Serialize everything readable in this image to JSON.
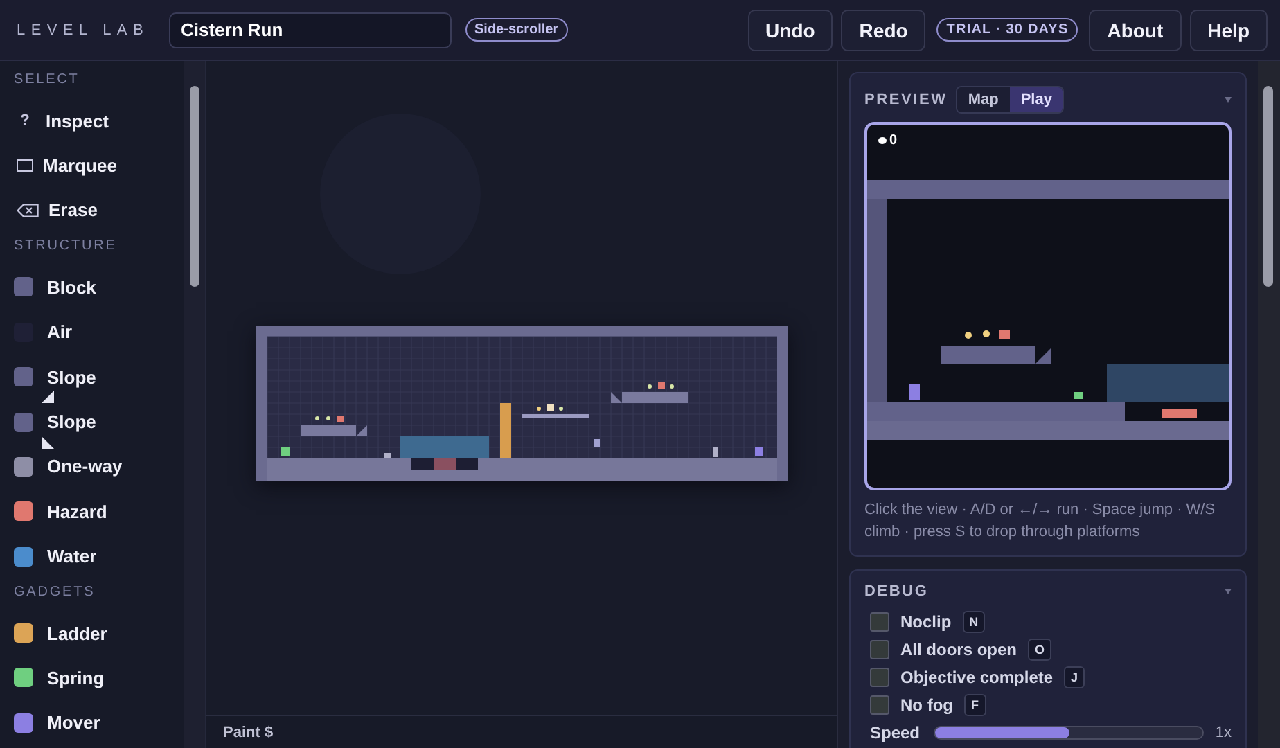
{
  "topbar": {
    "brand": "LEVEL LAB",
    "title_field": {
      "value": "Cistern Run"
    },
    "mode_badge": "Side-scroller",
    "buttons": [
      "Undo",
      "Redo"
    ],
    "trial_badge": "TRIAL · 30 DAYS",
    "links": [
      "About",
      "Help"
    ]
  },
  "palette": [
    {
      "heading": "SELECT",
      "items": [
        {
          "label": "Inspect",
          "kind": "inspect",
          "glyph": "?"
        },
        {
          "label": "Marquee",
          "kind": "marquee"
        },
        {
          "label": "Erase",
          "kind": "erase"
        }
      ]
    },
    {
      "heading": "STRUCTURE",
      "items": [
        {
          "label": "Block",
          "kind": "swatch",
          "color": "#62628a"
        },
        {
          "label": "Air",
          "kind": "swatch",
          "color": "#1f2036"
        },
        {
          "label": "Slope",
          "kind": "slopeup",
          "color": "#62628a"
        },
        {
          "label": "Slope",
          "kind": "slopedown",
          "color": "#62628a"
        },
        {
          "label": "One-way",
          "kind": "swatch",
          "color": "#8e8ea6"
        },
        {
          "label": "Hazard",
          "kind": "swatch",
          "color": "#e0786f"
        },
        {
          "label": "Water",
          "kind": "swatch",
          "color": "#4b8ccc"
        }
      ]
    },
    {
      "heading": "GADGETS",
      "items": [
        {
          "label": "Ladder",
          "kind": "swatch",
          "color": "#dca456"
        },
        {
          "label": "Spring",
          "kind": "swatch",
          "color": "#6fcf80"
        },
        {
          "label": "Mover",
          "kind": "swatch",
          "color": "#8c7fe2"
        }
      ]
    }
  ],
  "status_bar": "Paint $",
  "preview": {
    "heading": "PREVIEW",
    "tabs": [
      {
        "label": "Map",
        "selected": false
      },
      {
        "label": "Play",
        "selected": true
      }
    ],
    "coins": "0",
    "hint": "Click the view · A/D or ←/→ run · Space jump · W/S climb · press S to drop through platforms"
  },
  "debug": {
    "heading": "DEBUG",
    "toggles": [
      {
        "label": "Noclip",
        "key": "N",
        "checked": false
      },
      {
        "label": "All doors open",
        "key": "O",
        "checked": false
      },
      {
        "label": "Objective complete",
        "key": "J",
        "checked": false
      },
      {
        "label": "No fog",
        "key": "F",
        "checked": false
      }
    ],
    "speed": {
      "label": "Speed",
      "level": 0.5,
      "reading": "1x"
    }
  }
}
